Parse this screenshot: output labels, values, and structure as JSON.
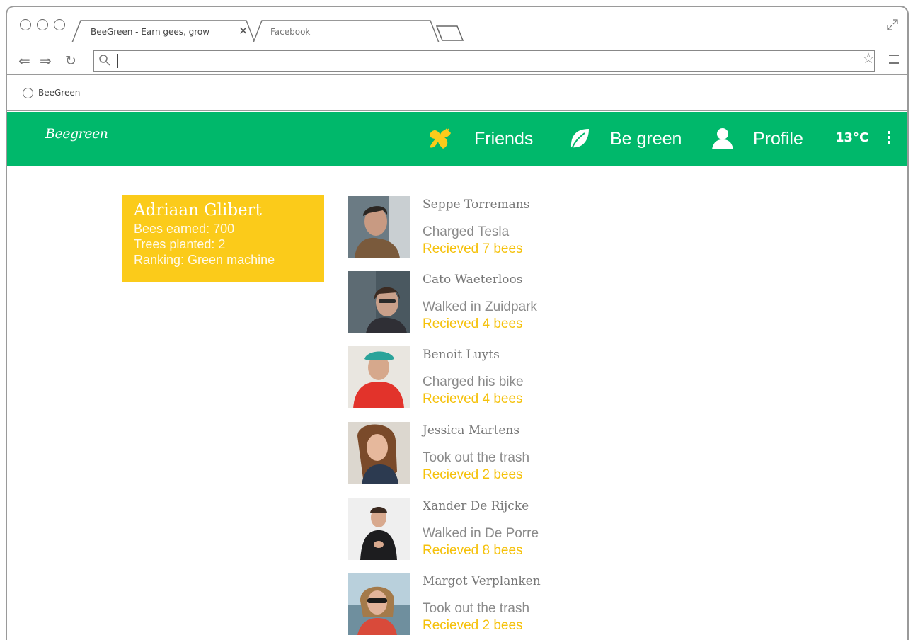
{
  "browser": {
    "tabs": [
      {
        "label": "BeeGreen - Earn gees, grow"
      },
      {
        "label": "Facebook"
      }
    ],
    "url": "",
    "bookmark": {
      "label": "BeeGreen"
    }
  },
  "app": {
    "logo": "Beegreen",
    "nav": [
      {
        "label": "Friends",
        "icon": "bee-icon"
      },
      {
        "label": "Be green",
        "icon": "leaf-icon"
      },
      {
        "label": "Profile",
        "icon": "person-icon"
      }
    ],
    "temperature": "13°C",
    "colors": {
      "header": "#00b86b",
      "accent": "#fbcb1a",
      "reward": "#f5c10a"
    }
  },
  "user": {
    "name": "Adriaan Glibert",
    "bees": "Bees earned: 700",
    "trees": "Trees planted: 2",
    "ranking": "Ranking: Green machine"
  },
  "feed": [
    {
      "name": "Seppe Torremans",
      "action": "Charged Tesla",
      "reward": "Recieved 7 bees"
    },
    {
      "name": "Cato Waeterloos",
      "action": "Walked in Zuidpark",
      "reward": "Recieved 4 bees"
    },
    {
      "name": "Benoit Luyts",
      "action": "Charged his bike",
      "reward": "Recieved 4 bees"
    },
    {
      "name": "Jessica Martens",
      "action": "Took out the trash",
      "reward": "Recieved 2 bees"
    },
    {
      "name": "Xander De Rijcke",
      "action": "Walked in De Porre",
      "reward": "Recieved 8 bees"
    },
    {
      "name": "Margot Verplanken",
      "action": "Took out the trash",
      "reward": "Recieved 2 bees"
    }
  ]
}
